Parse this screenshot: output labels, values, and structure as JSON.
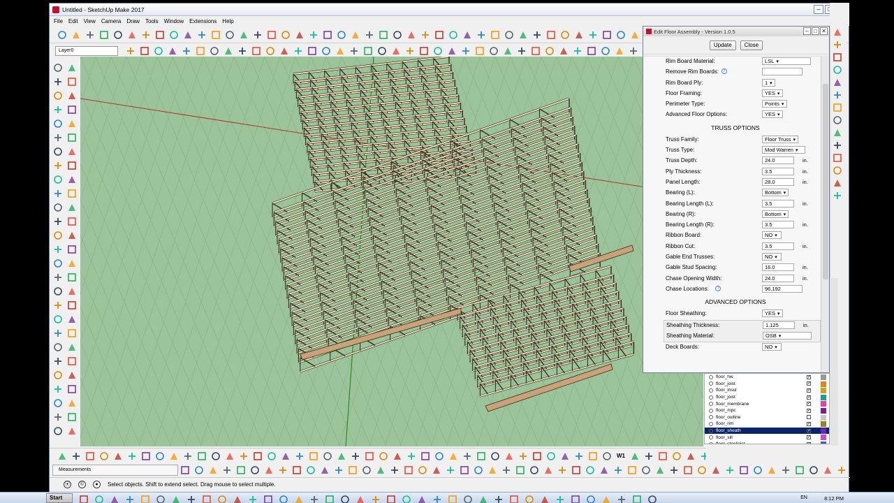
{
  "window": {
    "title": "Untitled - SketchUp Make 2017",
    "controls": [
      "–",
      "□",
      "✕"
    ]
  },
  "menu": [
    "File",
    "Edit",
    "View",
    "Camera",
    "Draw",
    "Tools",
    "Window",
    "Extensions",
    "Help"
  ],
  "layer_select": {
    "value": "Layer0"
  },
  "measurements": {
    "label": "Measurements"
  },
  "status": {
    "text": "Select objects. Shift to extend select. Drag mouse to select multiple."
  },
  "bottom_toolbar": {
    "w1_label": "W1"
  },
  "dialog": {
    "title": "Edit Floor Assembly - Version 1.0.5",
    "controls": [
      "–",
      "□",
      "✕"
    ],
    "update_label": "Update",
    "close_label": "Close",
    "rows_top": [
      {
        "label": "Rim Board Material:",
        "value": "LSL",
        "type": "select",
        "width": 70
      },
      {
        "label": "Remove Rim Boards:",
        "value": "",
        "type": "input",
        "width": 58,
        "help": true
      },
      {
        "label": "Rim Board Ply:",
        "value": "1",
        "type": "select",
        "width": 18
      },
      {
        "label": "Floor Framing:",
        "value": "YES",
        "type": "select",
        "width": 28
      },
      {
        "label": "Perimeter Type:",
        "value": "Points",
        "type": "select",
        "width": 36
      },
      {
        "label": "Advanced Floor Options:",
        "value": "YES",
        "type": "select",
        "width": 28
      }
    ],
    "truss_heading": "TRUSS OPTIONS",
    "rows_truss": [
      {
        "label": "Truss Family:",
        "value": "Floor Truss",
        "type": "select",
        "width": 52
      },
      {
        "label": "Truss Type:",
        "value": "Mod Warren",
        "type": "select",
        "width": 62
      },
      {
        "label": "Truss Depth:",
        "value": "24.0",
        "type": "input",
        "unit": "in.",
        "width": 46
      },
      {
        "label": "Ply Thickness:",
        "value": "3.5",
        "type": "input",
        "unit": "in.",
        "width": 46
      },
      {
        "label": "Panel Length:",
        "value": "28.0",
        "type": "input",
        "unit": "in.",
        "width": 46
      },
      {
        "label": "Bearing (L):",
        "value": "Bottom",
        "type": "select",
        "width": 38
      },
      {
        "label": "Bearing Length (L):",
        "value": "3.5",
        "type": "input",
        "unit": "in.",
        "width": 46
      },
      {
        "label": "Bearing (R):",
        "value": "Bottom",
        "type": "select",
        "width": 38
      },
      {
        "label": "Bearing Length (R):",
        "value": "3.5",
        "type": "input",
        "unit": "in.",
        "width": 46
      },
      {
        "label": "Ribbon Board:",
        "value": "NO",
        "type": "select",
        "width": 28
      },
      {
        "label": "Ribbon Cut:",
        "value": "3.5",
        "type": "input",
        "unit": "in.",
        "width": 46
      },
      {
        "label": "Gable End Trusses:",
        "value": "NO",
        "type": "select",
        "width": 28
      },
      {
        "label": "Gable Stud Spacing:",
        "value": "16.0",
        "type": "input",
        "unit": "in.",
        "width": 46
      },
      {
        "label": "Chase Opening Width:",
        "value": "24.0",
        "type": "input",
        "unit": "in.",
        "width": 46
      },
      {
        "label": "Chase Locations:",
        "value": "96,192",
        "type": "input",
        "width": 58,
        "help": true
      }
    ],
    "advanced_heading": "ADVANCED OPTIONS",
    "rows_advanced": [
      {
        "label": "Floor Sheathing:",
        "value": "YES",
        "type": "select",
        "width": 28
      }
    ],
    "rows_sheath": [
      {
        "label": "Sheathing Thickness:",
        "value": "1.125",
        "type": "input",
        "unit": "in.",
        "width": 46
      },
      {
        "label": "Sheathing Material:",
        "value": "OSB",
        "type": "select",
        "width": 70
      }
    ],
    "rows_bottom": [
      {
        "label": "Deck Boards:",
        "value": "NO",
        "type": "select",
        "width": 28
      }
    ]
  },
  "layers": [
    {
      "name": "floor_hw",
      "checked": true,
      "color": "#9a9a9a",
      "selected": false
    },
    {
      "name": "floor_joist",
      "checked": true,
      "color": "#d08a1f",
      "selected": false
    },
    {
      "name": "floor_insul",
      "checked": true,
      "color": "#d4a017",
      "selected": false
    },
    {
      "name": "floor_joist",
      "checked": true,
      "color": "#1aa08a",
      "selected": false
    },
    {
      "name": "floor_membrane",
      "checked": true,
      "color": "#e040b0",
      "selected": false
    },
    {
      "name": "floor_mpc",
      "checked": true,
      "color": "#7a1e9a",
      "selected": false
    },
    {
      "name": "floor_outline",
      "checked": false,
      "color": "#c8c8c8",
      "selected": false
    },
    {
      "name": "floor_rim",
      "checked": true,
      "color": "#8a8a20",
      "selected": false
    },
    {
      "name": "floor_sheath",
      "checked": true,
      "color": "#7020c0",
      "selected": true
    },
    {
      "name": "floor_sill",
      "checked": true,
      "color": "#c050c8",
      "selected": false
    },
    {
      "name": "floor_steeljoist",
      "checked": true,
      "color": "#4060c0",
      "selected": false
    }
  ],
  "taskbar": {
    "start": "Start",
    "lang": "EN",
    "clock": "8:12 PM"
  },
  "colors": {
    "viewport_bg": "#9bc49a",
    "truss_wood": "#e6dcb8",
    "rim_board": "#c9a27a",
    "selection_blue": "#0a246a"
  }
}
